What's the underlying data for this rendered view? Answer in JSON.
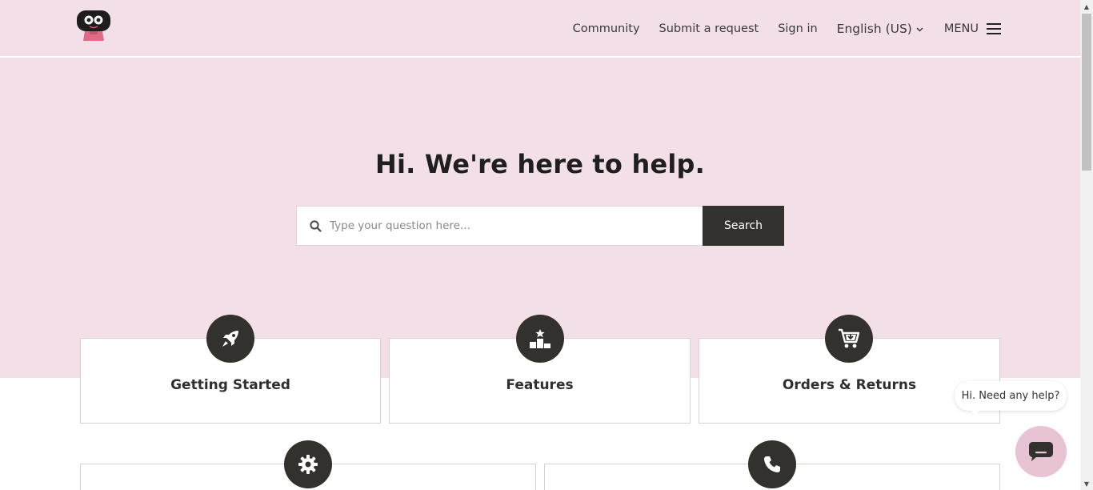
{
  "header": {
    "logo_alt": "Robot logo",
    "nav": {
      "community": "Community",
      "submit_request": "Submit a request",
      "sign_in": "Sign in",
      "language": "English (US)",
      "menu": "MENU"
    }
  },
  "hero": {
    "title": "Hi. We're here to help.",
    "search": {
      "placeholder": "Type your question here...",
      "value": "",
      "button_label": "Search"
    }
  },
  "categories": [
    {
      "label": "Getting Started",
      "icon": "rocket-icon"
    },
    {
      "label": "Features",
      "icon": "podium-star-icon"
    },
    {
      "label": "Orders & Returns",
      "icon": "cart-icon"
    },
    {
      "label": "",
      "icon": "gear-icon"
    },
    {
      "label": "",
      "icon": "phone-icon"
    }
  ],
  "chat": {
    "bubble_text": "Hi. Need any help?",
    "button_icon": "chat-icon"
  },
  "colors": {
    "brand_pink": "#f2dfe8",
    "dark": "#32312d",
    "chat_button": "#e8c3d3"
  }
}
